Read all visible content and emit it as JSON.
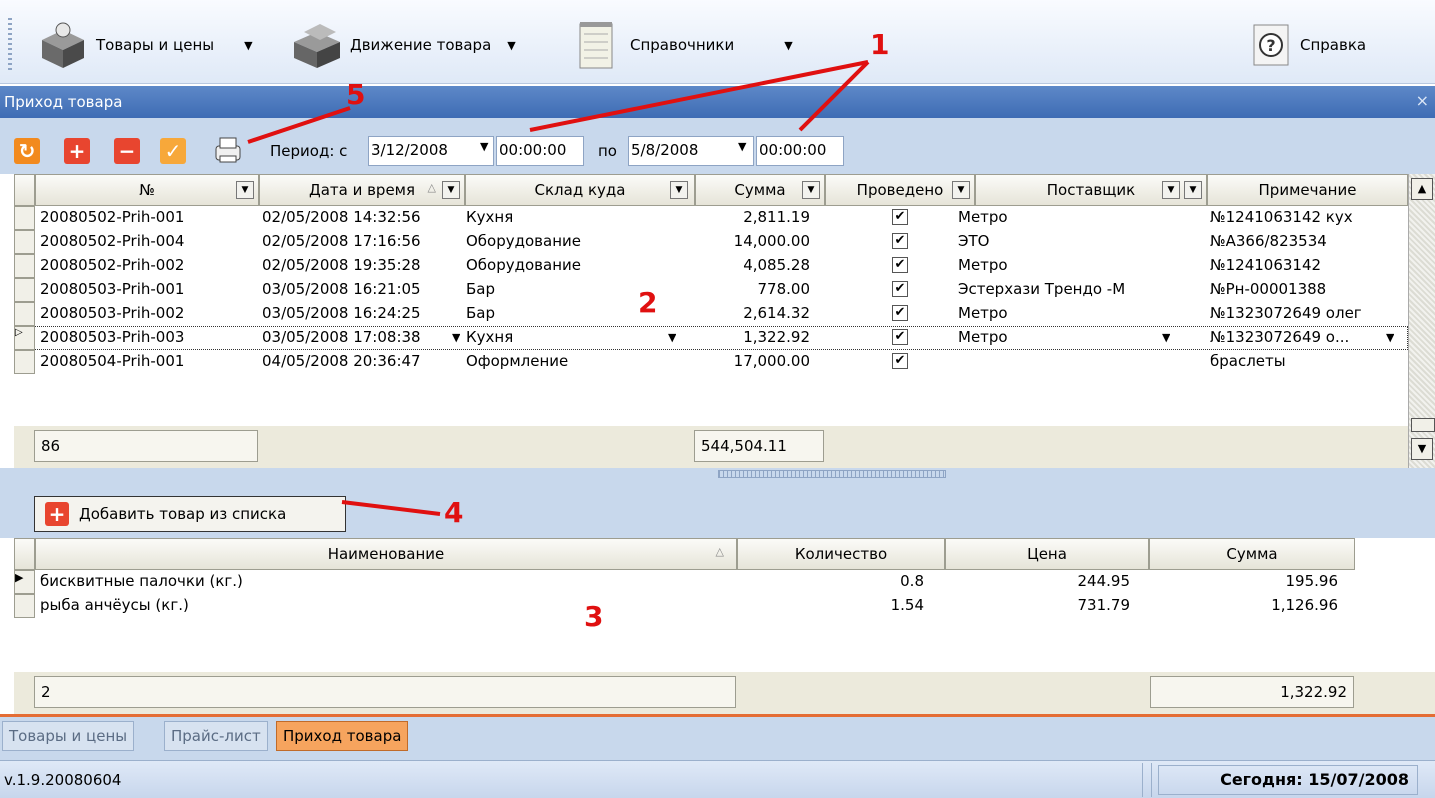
{
  "toolbar": {
    "goods_prices": "Товары и цены",
    "goods_movement": "Движение товара",
    "references": "Справочники",
    "help": "Справка"
  },
  "window": {
    "title": "Приход товара",
    "close": "×"
  },
  "period": {
    "label": "Период: с",
    "from_date": "3/12/2008",
    "from_time": "00:00:00",
    "to_label": "по",
    "to_date": "5/8/2008",
    "to_time": "00:00:00"
  },
  "grid1": {
    "columns": [
      "№",
      "Дата и время",
      "Склад куда",
      "Сумма",
      "Проведено",
      "Поставщик",
      "Примечание"
    ],
    "rows": [
      {
        "no": "20080502-Prih-001",
        "date": "02/05/2008 14:32:56",
        "warehouse": "Кухня",
        "sum": "2,811.19",
        "posted": true,
        "supplier": "Метро",
        "note": "№1241063142 кух"
      },
      {
        "no": "20080502-Prih-004",
        "date": "02/05/2008 17:16:56",
        "warehouse": "Оборудование",
        "sum": "14,000.00",
        "posted": true,
        "supplier": "ЭТО",
        "note": "№А366/823534"
      },
      {
        "no": "20080502-Prih-002",
        "date": "02/05/2008 19:35:28",
        "warehouse": "Оборудование",
        "sum": "4,085.28",
        "posted": true,
        "supplier": "Метро",
        "note": "№1241063142"
      },
      {
        "no": "20080503-Prih-001",
        "date": "03/05/2008 16:21:05",
        "warehouse": "Бар",
        "sum": "778.00",
        "posted": true,
        "supplier": "Эстерхази  Трендо -М",
        "note": "№Рн-00001388"
      },
      {
        "no": "20080503-Prih-002",
        "date": "03/05/2008 16:24:25",
        "warehouse": "Бар",
        "sum": "2,614.32",
        "posted": true,
        "supplier": "Метро",
        "note": "№1323072649 олег"
      },
      {
        "no": "20080503-Prih-003",
        "date": "03/05/2008 17:08:38",
        "warehouse": "Кухня",
        "sum": "1,322.92",
        "posted": true,
        "supplier": "Метро",
        "note": "№1323072649 о..."
      },
      {
        "no": "20080504-Prih-001",
        "date": "04/05/2008 20:36:47",
        "warehouse": "Оформление",
        "sum": "17,000.00",
        "posted": true,
        "supplier": "",
        "note": "браслеты"
      }
    ],
    "footer_count": "86",
    "footer_sum": "544,504.11"
  },
  "add_button": "Добавить товар из списка",
  "grid2": {
    "columns": [
      "Наименование",
      "Количество",
      "Цена",
      "Сумма"
    ],
    "rows": [
      {
        "name": "бисквитные палочки (кг.)",
        "qty": "0.8",
        "price": "244.95",
        "sum": "195.96"
      },
      {
        "name": "рыба анчёусы (кг.)",
        "qty": "1.54",
        "price": "731.79",
        "sum": "1,126.96"
      }
    ],
    "footer_count": "2",
    "footer_sum": "1,322.92"
  },
  "tabs": [
    "Товары и цены",
    "Прайс-лист",
    "Приход товара"
  ],
  "status": {
    "version": "v.1.9.20080604",
    "today": "Сегодня: 15/07/2008"
  },
  "annotations": [
    "1",
    "2",
    "3",
    "4",
    "5"
  ],
  "colors": {
    "accent_orange": "#f6a45e",
    "title_blue": "#4a78c0",
    "annotation_red": "#e01010"
  }
}
